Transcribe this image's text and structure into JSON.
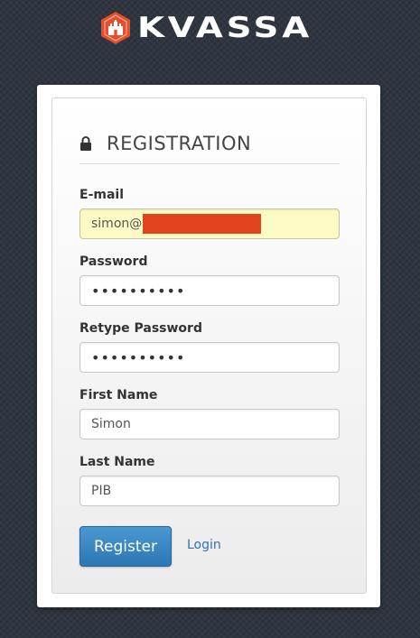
{
  "brand": {
    "name": "KVASSA",
    "badge_color": "#e3502c"
  },
  "form": {
    "title": "REGISTRATION",
    "fields": [
      {
        "label": "E-mail",
        "value": "simon@",
        "redacted": true
      },
      {
        "label": "Password",
        "value": "••••••••••"
      },
      {
        "label": "Retype Password",
        "value": "••••••••••"
      },
      {
        "label": "First Name",
        "value": "Simon"
      },
      {
        "label": "Last Name",
        "value": "PIB"
      }
    ],
    "register_label": "Register",
    "login_label": "Login"
  },
  "colors": {
    "background": "#2f3641",
    "primary_button": "#3482c1",
    "link": "#2f72b5",
    "autofill": "#fbfbc5"
  }
}
